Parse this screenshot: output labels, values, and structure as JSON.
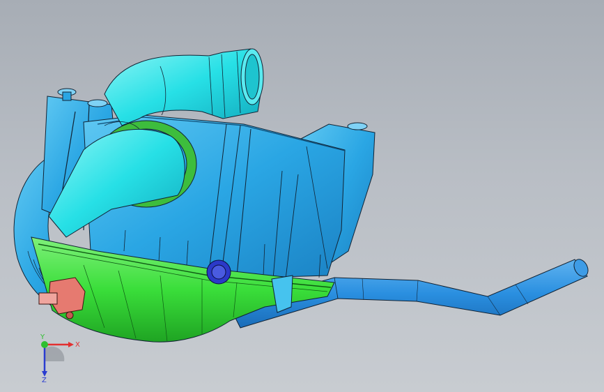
{
  "viewport": {
    "background_top": "#a7adb5",
    "background_bottom": "#c8ccd1",
    "model": "air-filter-housing-assembly"
  },
  "colors": {
    "housing": "#29a9e6",
    "housing_dark": "#1e86c6",
    "intake_tube": "#24e0e6",
    "intake_tube_dark": "#13b7c4",
    "lower_cover": "#39e23a",
    "lower_cover_dark": "#20b524",
    "outlet_pipe": "#2a8fe0",
    "connector": "#e67a70",
    "clip": "#2b39c8"
  },
  "triad": {
    "x_label": "X",
    "y_label": "Y",
    "z_label": "Z",
    "x_color": "#e23030",
    "y_color": "#2fbf2f",
    "z_color": "#2a3cd0"
  }
}
